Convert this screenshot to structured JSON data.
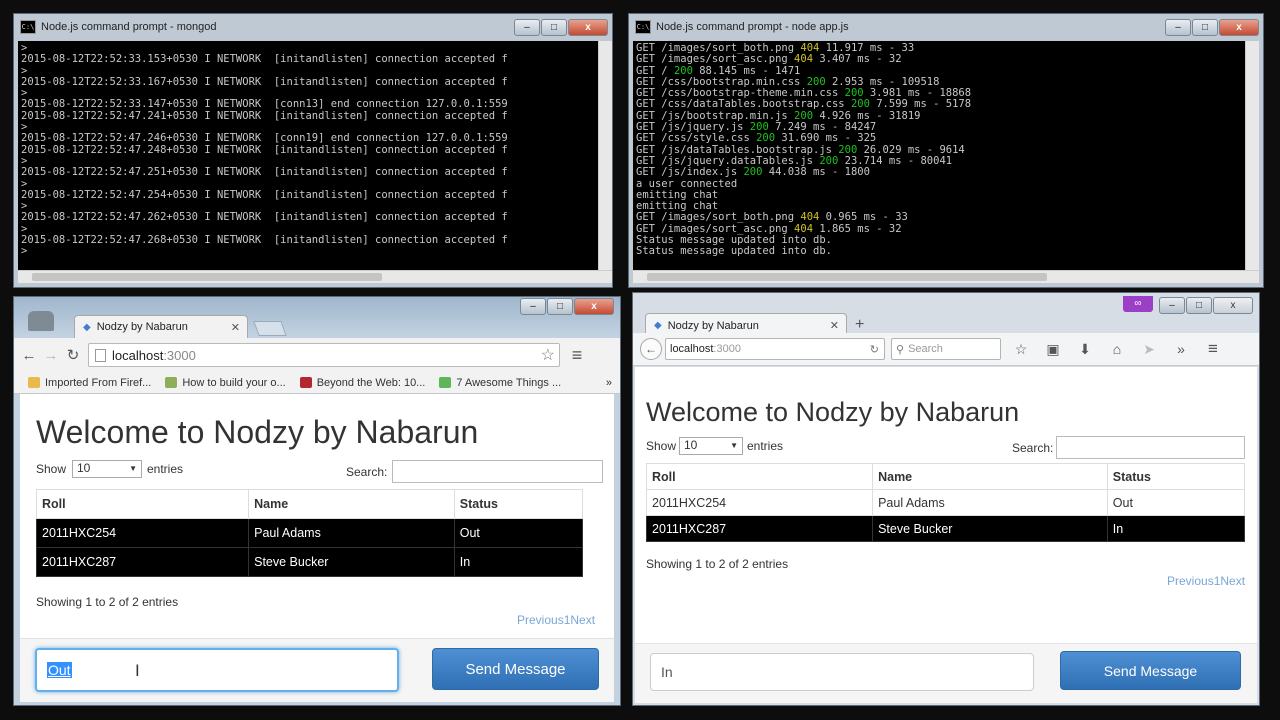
{
  "mongod_window": {
    "title": "Node.js command prompt - mongod",
    "icon": "cmd-icon",
    "lines": [
      ">",
      "2015-08-12T22:52:33.153+0530 I NETWORK  [initandlisten] connection accepted f",
      ">",
      "2015-08-12T22:52:33.167+0530 I NETWORK  [initandlisten] connection accepted f",
      ">",
      "2015-08-12T22:52:33.147+0530 I NETWORK  [conn13] end connection 127.0.0.1:559",
      "2015-08-12T22:52:47.241+0530 I NETWORK  [initandlisten] connection accepted f",
      ">",
      "2015-08-12T22:52:47.246+0530 I NETWORK  [conn19] end connection 127.0.0.1:559",
      "2015-08-12T22:52:47.248+0530 I NETWORK  [initandlisten] connection accepted f",
      ">",
      "2015-08-12T22:52:47.251+0530 I NETWORK  [initandlisten] connection accepted f",
      ">",
      "2015-08-12T22:52:47.254+0530 I NETWORK  [initandlisten] connection accepted f",
      ">",
      "2015-08-12T22:52:47.262+0530 I NETWORK  [initandlisten] connection accepted f",
      ">",
      "2015-08-12T22:52:47.268+0530 I NETWORK  [initandlisten] connection accepted f",
      ">"
    ]
  },
  "node_window": {
    "title": "Node.js command prompt - node  app.js",
    "icon": "cmd-icon",
    "lines": [
      {
        "pre": "GET /images/sort_both.png ",
        "code": "404",
        "post": " 11.917 ms - 33"
      },
      {
        "pre": "GET /images/sort_asc.png ",
        "code": "404",
        "post": " 3.407 ms - 32"
      },
      {
        "pre": "GET / ",
        "code": "200",
        "post": " 88.145 ms - 1471"
      },
      {
        "pre": "GET /css/bootstrap.min.css ",
        "code": "200",
        "post": " 2.953 ms - 109518"
      },
      {
        "pre": "GET /css/bootstrap-theme.min.css ",
        "code": "200",
        "post": " 3.981 ms - 18868"
      },
      {
        "pre": "GET /css/dataTables.bootstrap.css ",
        "code": "200",
        "post": " 7.599 ms - 5178"
      },
      {
        "pre": "GET /js/bootstrap.min.js ",
        "code": "200",
        "post": " 4.926 ms - 31819"
      },
      {
        "pre": "GET /js/jquery.js ",
        "code": "200",
        "post": " 7.249 ms - 84247"
      },
      {
        "pre": "GET /css/style.css ",
        "code": "200",
        "post": " 31.690 ms - 325"
      },
      {
        "pre": "GET /js/dataTables.bootstrap.js ",
        "code": "200",
        "post": " 26.029 ms - 9614"
      },
      {
        "pre": "GET /js/jquery.dataTables.js ",
        "code": "200",
        "post": " 23.714 ms - 80041"
      },
      {
        "pre": "GET /js/index.js ",
        "code": "200",
        "post": " 44.038 ms - 1800"
      },
      {
        "pre": "a user connected",
        "code": "",
        "post": ""
      },
      {
        "pre": "emitting chat",
        "code": "",
        "post": ""
      },
      {
        "pre": "emitting chat",
        "code": "",
        "post": ""
      },
      {
        "pre": "GET /images/sort_both.png ",
        "code": "404",
        "post": " 0.965 ms - 33"
      },
      {
        "pre": "GET /images/sort_asc.png ",
        "code": "404",
        "post": " 1.865 ms - 32"
      },
      {
        "pre": "Status message updated into db.",
        "code": "",
        "post": ""
      },
      {
        "pre": "Status message updated into db.",
        "code": "",
        "post": ""
      }
    ]
  },
  "window_controls": {
    "minimize": "–",
    "maximize": "□",
    "close": "x"
  },
  "chrome": {
    "tab_title": "Nodzy by Nabarun",
    "tab_close": "✕",
    "url_host": "localhost",
    "url_port": ":3000",
    "back": "←",
    "forward": "→",
    "reload": "↻",
    "star": "☆",
    "menu": "≡",
    "bookmarks": [
      {
        "label": "Imported From Firef...",
        "color": "#e9b949"
      },
      {
        "label": "How to build your o...",
        "color": "#8fae5a"
      },
      {
        "label": "Beyond the Web: 10...",
        "color": "#b3272e"
      },
      {
        "label": "7 Awesome Things ...",
        "color": "#5fb55a"
      }
    ],
    "bookmarks_more": "»"
  },
  "firefox": {
    "tab_title": "Nodzy by Nabarun",
    "tab_close": "✕",
    "new_tab": "+",
    "url_host": "localhost",
    "url_port": ":3000",
    "search_placeholder": "Search",
    "mask_icon": "∞",
    "back": "←"
  },
  "left_page": {
    "heading": "Welcome to Nodzy by Nabarun",
    "show_label": "Show",
    "show_value": "10",
    "entries_label": "entries",
    "search_label": "Search:",
    "columns": [
      "Roll",
      "Name",
      "Status"
    ],
    "rows": [
      {
        "roll": "2011HXC254",
        "name": "Paul Adams",
        "status": "Out"
      },
      {
        "roll": "2011HXC287",
        "name": "Steve Bucker",
        "status": "In"
      }
    ],
    "info": "Showing 1 to 2 of 2 entries",
    "pager": "Previous1Next",
    "message_value": "Out",
    "send_label": "Send Message"
  },
  "right_page": {
    "heading": "Welcome to Nodzy by Nabarun",
    "show_label": "Show",
    "show_value": "10",
    "entries_label": "entries",
    "search_label": "Search:",
    "columns": [
      "Roll",
      "Name",
      "Status"
    ],
    "rows": [
      {
        "roll": "2011HXC254",
        "name": "Paul Adams",
        "status": "Out"
      },
      {
        "roll": "2011HXC287",
        "name": "Steve Bucker",
        "status": "In"
      }
    ],
    "info": "Showing 1 to 2 of 2 entries",
    "pager": "Previous1Next",
    "message_value": "In",
    "send_label": "Send Message"
  },
  "colors": {
    "status_ok": "#1fc21f",
    "status_warn": "#d0c22a",
    "send_button": "#337ab7",
    "selected_row": "#000000",
    "pager_link": "#7aa6d6"
  }
}
